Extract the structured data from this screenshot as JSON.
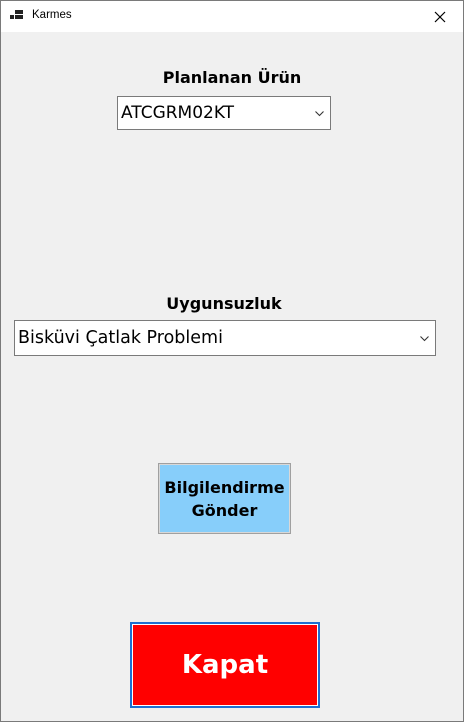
{
  "window": {
    "title": "Karmes",
    "app_icon": "app-icon",
    "close_icon": "close-icon"
  },
  "planned_product": {
    "label": "Planlanan Ürün",
    "selected": "ATCGRM02KT"
  },
  "nonconformity": {
    "label": "Uygunsuzluk",
    "selected": "Bisküvi Çatlak Problemi"
  },
  "notify_button": {
    "line1": "Bilgilendirme",
    "line2": "Gönder"
  },
  "close_button": {
    "label": "Kapat",
    "color": "#ff0000"
  },
  "colors": {
    "notify_button_bg": "#87cefa",
    "close_button_bg": "#ff0000",
    "close_button_border": "#1e6fd0"
  }
}
